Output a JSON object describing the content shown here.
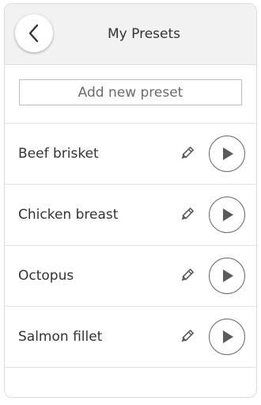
{
  "header": {
    "title": "My Presets",
    "back_icon": "chevron-left-icon"
  },
  "add_preset": {
    "label": "Add new preset"
  },
  "presets": [
    {
      "name": "Beef brisket"
    },
    {
      "name": "Chicken breast"
    },
    {
      "name": "Octopus"
    },
    {
      "name": "Salmon fillet"
    }
  ],
  "icons": {
    "edit": "pencil-icon",
    "start": "play-icon"
  },
  "colors": {
    "header_bg": "#f2f2f2",
    "text": "#333333",
    "icon": "#5a5a5a"
  }
}
